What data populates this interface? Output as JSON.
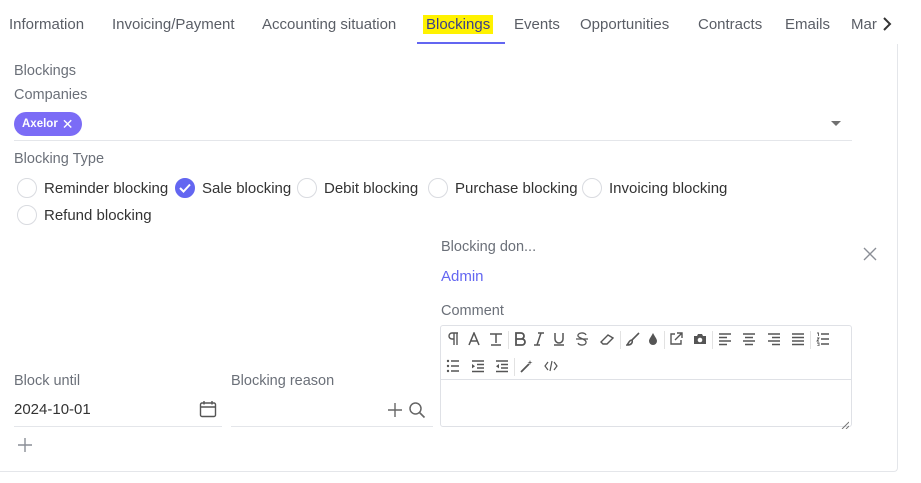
{
  "tabs": [
    {
      "label": "Information"
    },
    {
      "label": "Invoicing/Payment"
    },
    {
      "label": "Accounting situation"
    },
    {
      "label": "Blockings"
    },
    {
      "label": "Events"
    },
    {
      "label": "Opportunities"
    },
    {
      "label": "Contracts"
    },
    {
      "label": "Emails"
    },
    {
      "label": "Mar"
    }
  ],
  "active_tab": "Blockings",
  "section_title": "Blockings",
  "companies": {
    "label": "Companies",
    "tags": [
      {
        "label": "Axelor",
        "remove": "✕"
      }
    ]
  },
  "blocking_type": {
    "label": "Blocking Type",
    "options": [
      {
        "label": "Reminder blocking",
        "checked": false
      },
      {
        "label": "Sale blocking",
        "checked": true
      },
      {
        "label": "Debit blocking",
        "checked": false
      },
      {
        "label": "Purchase blocking",
        "checked": false
      },
      {
        "label": "Invoicing blocking",
        "checked": false
      },
      {
        "label": "Refund blocking",
        "checked": false
      }
    ]
  },
  "blocking_done_by": {
    "label": "Blocking don...",
    "value": "Admin"
  },
  "comment": {
    "label": "Comment",
    "value": ""
  },
  "block_until": {
    "label": "Block until",
    "value": "2024-10-01"
  },
  "blocking_reason": {
    "label": "Blocking reason",
    "value": ""
  },
  "colors": {
    "accent": "#6366f1",
    "tag": "#7b6cf6",
    "highlight": "#fff200"
  }
}
